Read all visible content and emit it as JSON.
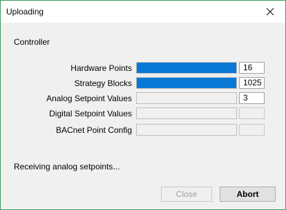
{
  "window": {
    "title": "Uploading"
  },
  "section": {
    "label": "Controller"
  },
  "rows": [
    {
      "label": "Hardware Points",
      "progress": 1.0,
      "count": "16",
      "enabled": true
    },
    {
      "label": "Strategy Blocks",
      "progress": 1.0,
      "count": "1025",
      "enabled": true
    },
    {
      "label": "Analog Setpoint Values",
      "progress": 0.0,
      "count": "3",
      "enabled": true
    },
    {
      "label": "Digital Setpoint Values",
      "progress": 0.0,
      "count": "",
      "enabled": false
    },
    {
      "label": "BACnet Point Config",
      "progress": 0.0,
      "count": "",
      "enabled": false
    }
  ],
  "status": {
    "text": "Receiving analog setpoints..."
  },
  "buttons": {
    "close_label": "Close",
    "abort_label": "Abort"
  },
  "colors": {
    "progress_fill": "#0a78d7",
    "window_border": "#3c9a5f"
  },
  "icons": {
    "close": "close-icon"
  }
}
